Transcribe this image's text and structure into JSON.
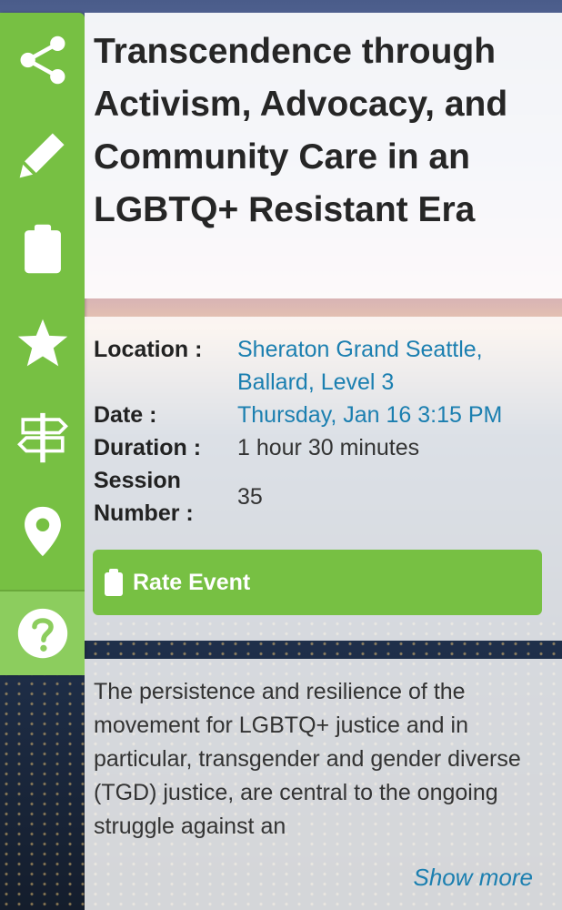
{
  "event": {
    "title": "Transcendence through Activism, Advocacy, and Community Care in an LGBTQ+ Resistant Era"
  },
  "details": {
    "location_label": "Location :",
    "location_value": "Sheraton Grand Seattle, Ballard, Level 3",
    "date_label": "Date :",
    "date_value": "Thursday, Jan 16 3:15 PM",
    "duration_label": "Duration :",
    "duration_value": "1 hour 30 minutes",
    "session_label": "Session Number :",
    "session_value": "35"
  },
  "actions": {
    "rate_label": "Rate Event"
  },
  "description": {
    "text": "The persistence and resilience of the movement for LGBTQ+ justice and in particular, transgender and gender diverse (TGD) justice, are central to the ongoing struggle against an",
    "show_more": "Show more"
  },
  "toolbar": {
    "icons": [
      "share-icon",
      "pencil-icon",
      "clipboard-icon",
      "star-icon",
      "signpost-icon",
      "map-pin-icon",
      "help-icon"
    ]
  },
  "colors": {
    "accent": "#77c043",
    "link": "#1b7fb0"
  }
}
